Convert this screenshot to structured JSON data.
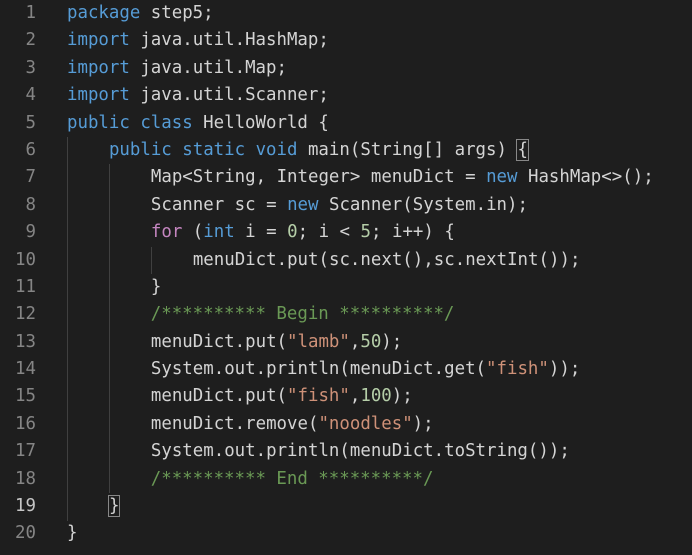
{
  "editor": {
    "language": "java",
    "line_numbers": [
      "1",
      "2",
      "3",
      "4",
      "5",
      "6",
      "7",
      "8",
      "9",
      "10",
      "11",
      "12",
      "13",
      "14",
      "15",
      "16",
      "17",
      "18",
      "19",
      "20"
    ],
    "active_line": "19",
    "lines": [
      "package step5;",
      "import java.util.HashMap;",
      "import java.util.Map;",
      "import java.util.Scanner;",
      "public class HelloWorld {",
      "    public static void main(String[] args) {",
      "        Map<String, Integer> menuDict = new HashMap<>();",
      "        Scanner sc = new Scanner(System.in);",
      "        for (int i = 0; i < 5; i++) {",
      "            menuDict.put(sc.next(),sc.nextInt());",
      "        }",
      "        /********** Begin **********/",
      "        menuDict.put(\"lamb\",50);",
      "        System.out.println(menuDict.get(\"fish\"));",
      "        menuDict.put(\"fish\",100);",
      "        menuDict.remove(\"noodles\");",
      "        System.out.println(menuDict.toString());",
      "        /********** End **********/",
      "    }",
      "}"
    ]
  },
  "colors": {
    "background": "#1e1e1e",
    "line_number": "#858585",
    "keyword": "#569cd6",
    "control_keyword": "#c586c0",
    "string": "#ce9178",
    "number": "#b5cea8",
    "comment": "#6a9955",
    "plain": "#d4d4d4"
  }
}
